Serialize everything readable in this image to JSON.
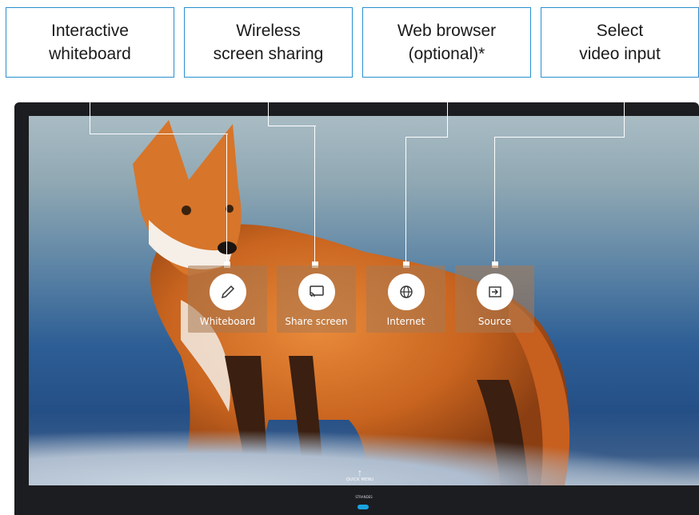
{
  "callouts": [
    {
      "id": "whiteboard",
      "text": "Interactive\nwhiteboard"
    },
    {
      "id": "share",
      "text": "Wireless\nscreen sharing"
    },
    {
      "id": "internet",
      "text": "Web browser\n(optional)*"
    },
    {
      "id": "source",
      "text": "Select\nvideo input"
    }
  ],
  "tiles": [
    {
      "label": "Whiteboard",
      "icon": "pencil-icon"
    },
    {
      "label": "Share screen",
      "icon": "cast-icon"
    },
    {
      "label": "Internet",
      "icon": "globe-icon"
    },
    {
      "label": "Source",
      "icon": "input-icon"
    }
  ],
  "quick_menu": {
    "arrow": "↑",
    "label": "QUICK MENU"
  },
  "brand": "STRANDES",
  "colors": {
    "callout_border": "#2a8fcf",
    "tile_bg": "#aa7850",
    "power_led": "#1aa4e0"
  }
}
